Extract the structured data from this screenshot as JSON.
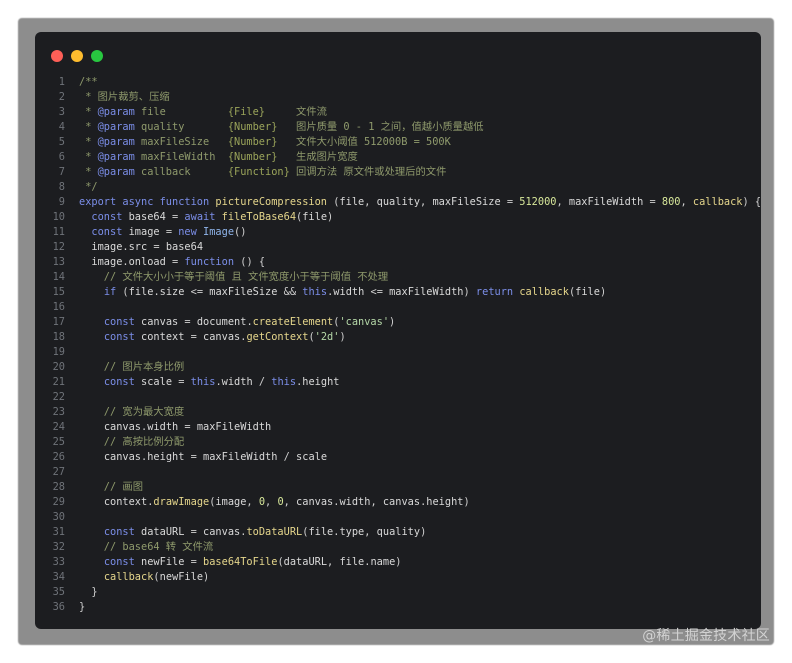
{
  "window": {
    "controls": [
      "close",
      "minimize",
      "maximize"
    ]
  },
  "code_lines": [
    {
      "no": "1",
      "text": "/**"
    },
    {
      "no": "2",
      "text": " * 图片裁剪、压缩"
    },
    {
      "no": "3",
      "text": " * @param file          {File}     文件流"
    },
    {
      "no": "4",
      "text": " * @param quality       {Number}   图片质量 0 - 1 之间，值越小质量越低"
    },
    {
      "no": "5",
      "text": " * @param maxFileSize   {Number}   文件大小阈值 512000B = 500K"
    },
    {
      "no": "6",
      "text": " * @param maxFileWidth  {Number}   生成图片宽度"
    },
    {
      "no": "7",
      "text": " * @param callback      {Function} 回调方法 原文件或处理后的文件"
    },
    {
      "no": "8",
      "text": " */"
    },
    {
      "no": "9",
      "text": "export async function pictureCompression (file, quality, maxFileSize = 512000, maxFileWidth = 800, callback) {"
    },
    {
      "no": "10",
      "text": "  const base64 = await fileToBase64(file)"
    },
    {
      "no": "11",
      "text": "  const image = new Image()"
    },
    {
      "no": "12",
      "text": "  image.src = base64"
    },
    {
      "no": "13",
      "text": "  image.onload = function () {"
    },
    {
      "no": "14",
      "text": "    // 文件大小小于等于阈值 且 文件宽度小于等于阈值 不处理"
    },
    {
      "no": "15",
      "text": "    if (file.size <= maxFileSize && this.width <= maxFileWidth) return callback(file)"
    },
    {
      "no": "16",
      "text": ""
    },
    {
      "no": "17",
      "text": "    const canvas = document.createElement('canvas')"
    },
    {
      "no": "18",
      "text": "    const context = canvas.getContext('2d')"
    },
    {
      "no": "19",
      "text": ""
    },
    {
      "no": "20",
      "text": "    // 图片本身比例"
    },
    {
      "no": "21",
      "text": "    const scale = this.width / this.height"
    },
    {
      "no": "22",
      "text": ""
    },
    {
      "no": "23",
      "text": "    // 宽为最大宽度"
    },
    {
      "no": "24",
      "text": "    canvas.width = maxFileWidth"
    },
    {
      "no": "25",
      "text": "    // 高按比例分配"
    },
    {
      "no": "26",
      "text": "    canvas.height = maxFileWidth / scale"
    },
    {
      "no": "27",
      "text": ""
    },
    {
      "no": "28",
      "text": "    // 画图"
    },
    {
      "no": "29",
      "text": "    context.drawImage(image, 0, 0, canvas.width, canvas.height)"
    },
    {
      "no": "30",
      "text": ""
    },
    {
      "no": "31",
      "text": "    const dataURL = canvas.toDataURL(file.type, quality)"
    },
    {
      "no": "32",
      "text": "    // base64 转 文件流"
    },
    {
      "no": "33",
      "text": "    const newFile = base64ToFile(dataURL, file.name)"
    },
    {
      "no": "34",
      "text": "    callback(newFile)"
    },
    {
      "no": "35",
      "text": "  }"
    },
    {
      "no": "36",
      "text": "}"
    }
  ],
  "watermark": "@稀土掘金技术社区"
}
